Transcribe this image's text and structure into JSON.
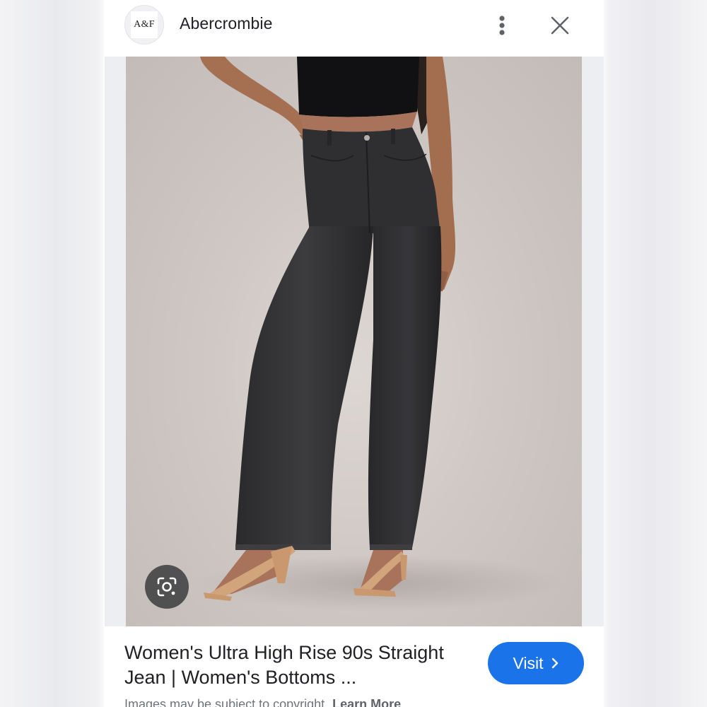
{
  "header": {
    "logo_text": "A&F",
    "source_name": "Abercrombie",
    "more_icon": "more-vert-icon",
    "close_icon": "close-icon"
  },
  "image": {
    "alt": "Women's Ultra High Rise 90s Straight Jean",
    "lens_icon": "google-lens-icon"
  },
  "footer": {
    "title": "Women's Ultra High Rise 90s Straight Jean | Women's Bottoms ...",
    "visit_label": "Visit",
    "visit_icon": "chevron-right-icon",
    "copyright_text": "Images may be subject to copyright.",
    "learn_more": "Learn More"
  },
  "colors": {
    "accent": "#1a73e8",
    "text": "#202124",
    "muted": "#70757a"
  }
}
